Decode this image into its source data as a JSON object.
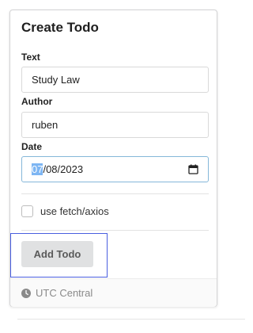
{
  "card": {
    "title": "Create Todo",
    "fields": {
      "text": {
        "label": "Text",
        "value": "Study Law"
      },
      "author": {
        "label": "Author",
        "value": "ruben"
      },
      "date": {
        "label": "Date",
        "month": "07",
        "rest": "/08/2023"
      }
    },
    "checkbox": {
      "label": "use fetch/axios",
      "checked": false
    },
    "add_button_label": "Add Todo",
    "footer_text": "UTC Central"
  },
  "colors": {
    "focus_outline": "#4a5fe0",
    "date_border": "#85b7d9",
    "date_highlight": "#7eb6f3",
    "button_bg": "#e0e1e2"
  },
  "icons": {
    "date": "calendar-icon",
    "footer": "clock-icon"
  }
}
